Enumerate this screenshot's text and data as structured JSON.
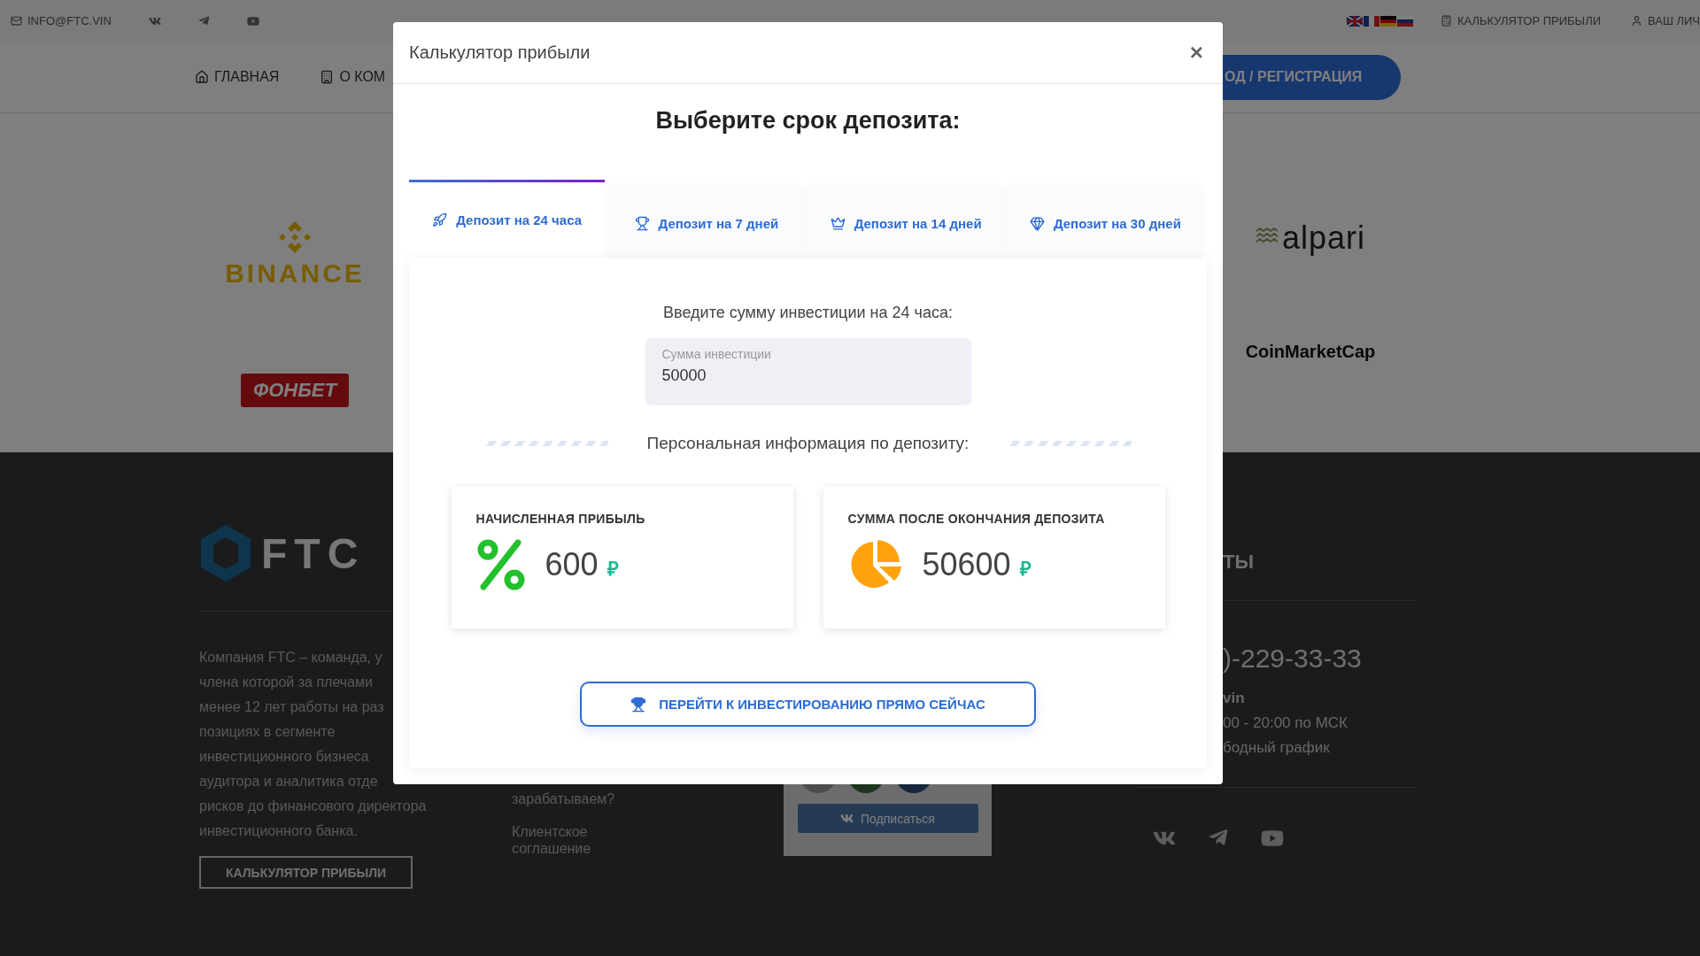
{
  "topbar": {
    "email": "INFO@FTC.VIN",
    "calculator_link": "КАЛЬКУЛЯТОР ПРИБЫЛИ",
    "account_link": "ВАШ ЛИЧ"
  },
  "nav": [
    {
      "label": "ГЛАВНАЯ"
    },
    {
      "label": "О КОМ"
    }
  ],
  "login_button": "ОД / РЕГИСТРАЦИЯ",
  "partners": [
    {
      "name": "BINANCE",
      "kind": "binance"
    },
    {
      "name": "ФОНБЕТ",
      "kind": "fonbet"
    },
    {
      "name": "alpari",
      "kind": "alpari"
    },
    {
      "name": "CoinMarketCap",
      "kind": "coinmarketcap"
    }
  ],
  "footer": {
    "logo": "FTC",
    "about_lines": [
      "Компания FTC – команда, у",
      "члена которой за плечами",
      "менее 12 лет работы на раз",
      "позициях в сегменте",
      "инвестиционного бизнеса",
      "аудитора и аналитика отде",
      "рисков до финансового директора",
      "инвестиционного банка."
    ],
    "calculator_button": "КАЛЬКУЛЯТОР ПРИБЫЛИ",
    "links": [
      "зарабатываем?",
      "Клиентское соглашение"
    ],
    "subscribe_button": "Подписаться",
    "contacts_heading": "ТЫ",
    "phone": ")-229-33-33",
    "contact_lines": [
      {
        "text": "vin",
        "kind": "bold"
      },
      {
        "text": "00 - 20:00 по МСК",
        "kind": "plain"
      },
      {
        "text": "бодный график",
        "kind": "plain"
      }
    ]
  },
  "modal": {
    "title": "Калькулятор прибыли",
    "close": "×",
    "heading": "Выберите срок депозита:",
    "tabs": [
      {
        "label": "Депозит на 24 часа",
        "selected": true
      },
      {
        "label": "Депозит на 7 дней",
        "selected": false
      },
      {
        "label": "Депозит на 14 дней",
        "selected": false
      },
      {
        "label": "Депозит на 30 дней",
        "selected": false
      }
    ],
    "prompt": "Введите сумму инвестиции на 24 часа:",
    "field": {
      "label": "Сумма инвестиции",
      "value": "50000"
    },
    "section_title": "Персональная информация по депозиту:",
    "cards": [
      {
        "title": "НАЧИСЛЕННАЯ ПРИБЫЛЬ",
        "value": "600",
        "currency": "₽"
      },
      {
        "title": "СУММА ПОСЛЕ ОКОНЧАНИЯ ДЕПОЗИТА",
        "value": "50600",
        "currency": "₽"
      }
    ],
    "action_button": "ПЕРЕЙТИ К ИНВЕСТИРОВАНИЮ ПРЯМО СЕЙЧАС"
  }
}
